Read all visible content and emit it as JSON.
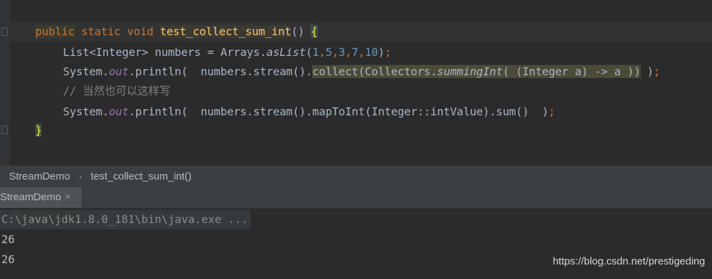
{
  "editor": {
    "line1": {
      "kw_public": "public",
      "kw_static": " static ",
      "kw_void": "void",
      "space": " ",
      "method_name": "test_collect_sum_int",
      "parens": "() ",
      "brace_open": "{"
    },
    "line2": {
      "decl": "List<Integer> numbers = Arrays.",
      "method": "asList",
      "open": "(",
      "n1": "1",
      "c1": ",",
      "n2": "5",
      "c2": ",",
      "n3": "3",
      "c3": ",",
      "n4": "7",
      "c4": ",",
      "n5": "10",
      "close": ")",
      "semi": ";"
    },
    "line3": {
      "sys": "System.",
      "out": "out",
      "println": ".println(  numbers.stream().",
      "collect_call": "collect(Collectors.",
      "summing": "summingInt",
      "lambda": "( (Integer a) -> a ))",
      "end": " )",
      "semi": ";"
    },
    "line4": {
      "comment": "// 当然也可以这样写"
    },
    "line5": {
      "sys": "System.",
      "out": "out",
      "rest": ".println(  numbers.stream().mapToInt(Integer::intValue).sum()  )",
      "semi": ";"
    },
    "line6": {
      "brace_close": "}"
    }
  },
  "breadcrumb": {
    "class_name": "StreamDemo",
    "separator": "›",
    "method_name": "test_collect_sum_int()"
  },
  "run_panel": {
    "tab_label": "StreamDemo",
    "close_glyph": "×"
  },
  "console": {
    "command": "C:\\java\\jdk1.8.0_181\\bin\\java.exe ...",
    "output": [
      "26",
      "26"
    ]
  },
  "watermark": "https://blog.csdn.net/prestigeding",
  "colors": {
    "background": "#2b2b2b",
    "keyword": "#cc7832",
    "method_decl": "#ffc66d",
    "number": "#6897bb",
    "field": "#9876aa",
    "comment": "#808080",
    "text": "#a9b7c6"
  }
}
